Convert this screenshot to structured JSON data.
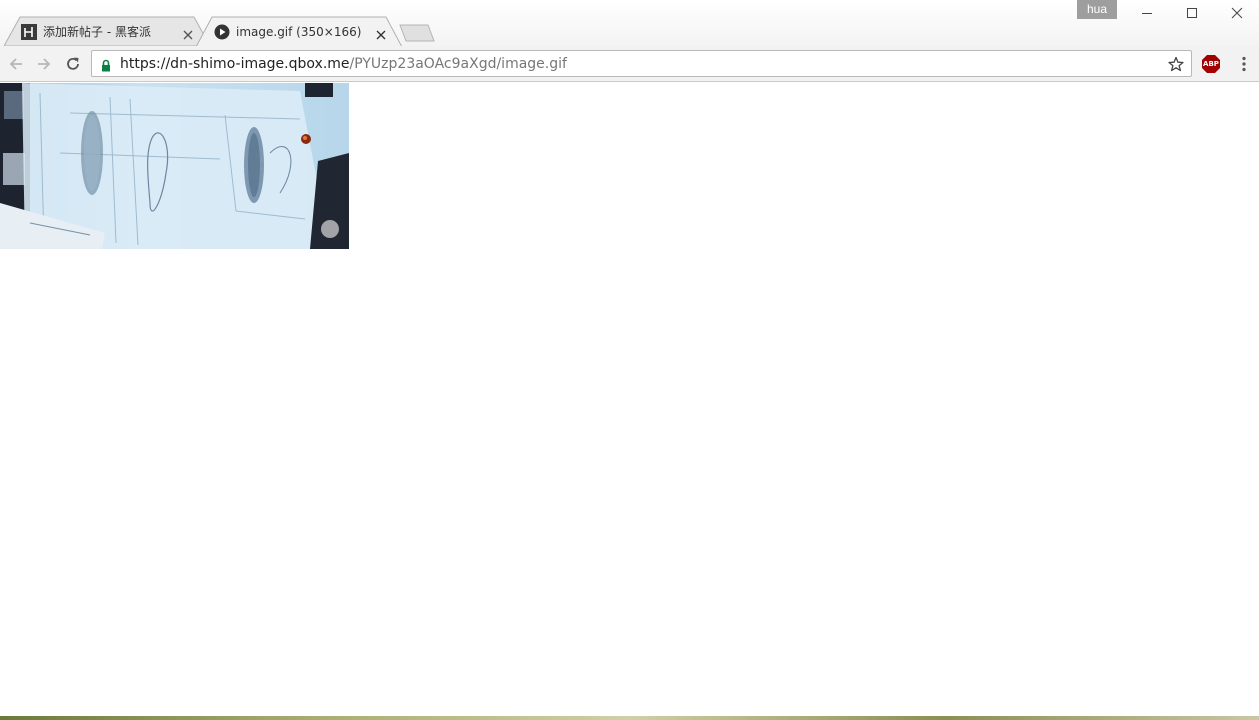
{
  "window": {
    "profile_name": "hua"
  },
  "tabs": [
    {
      "title": "添加新帖子 - 黑客派",
      "favicon": "hacpai-logo-icon",
      "active": false
    },
    {
      "title": "image.gif (350×166)",
      "favicon": "media-play-icon",
      "active": true
    }
  ],
  "toolbar": {
    "url_host": "https://dn-shimo-image.qbox.me",
    "url_path": "/PYUzp23aOAc9aXgd/image.gif",
    "extension_label": "ABP"
  },
  "content": {
    "image_alt": "image.gif",
    "image_natural_size": "350×166"
  },
  "colors": {
    "secure_lock": "#0b8043",
    "abp_red": "#a40000"
  }
}
